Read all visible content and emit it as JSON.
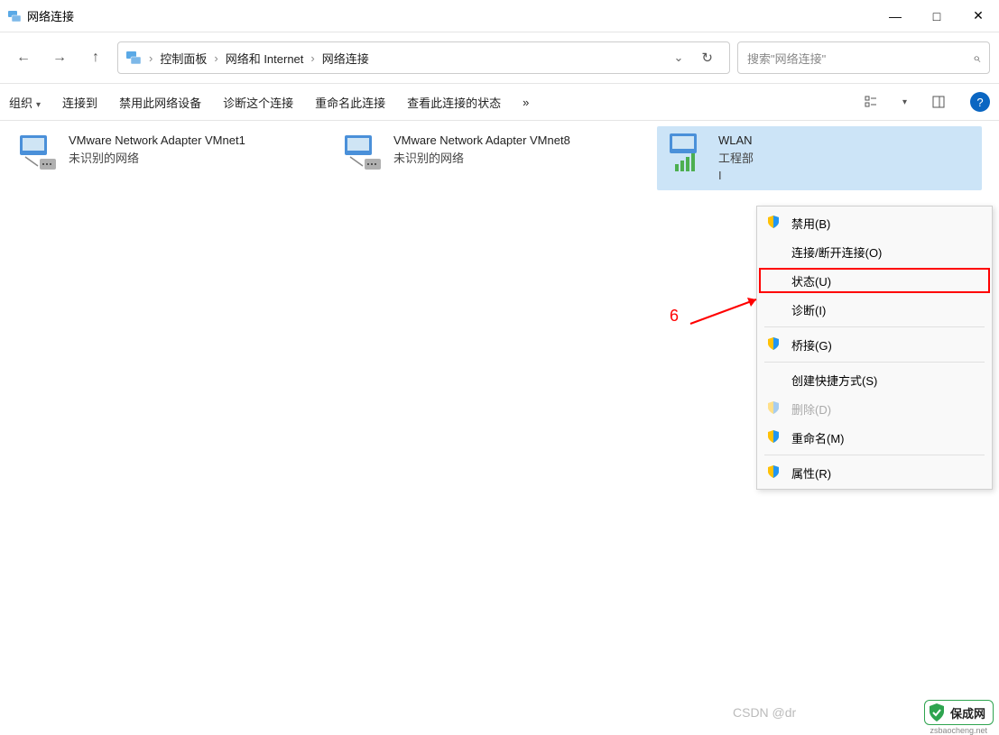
{
  "window": {
    "title": "网络连接",
    "minimize": "—",
    "maximize": "□",
    "close": "✕"
  },
  "breadcrumb": {
    "seg1": "控制面板",
    "seg2": "网络和 Internet",
    "seg3": "网络连接"
  },
  "search": {
    "placeholder": "搜索\"网络连接\""
  },
  "toolbar": {
    "organize": "组织",
    "connect": "连接到",
    "disable": "禁用此网络设备",
    "diagnose": "诊断这个连接",
    "rename": "重命名此连接",
    "viewstatus": "查看此连接的状态",
    "more": "»"
  },
  "adapters": [
    {
      "name": "VMware Network Adapter VMnet1",
      "status": "未识别的网络"
    },
    {
      "name": "VMware Network Adapter VMnet8",
      "status": "未识别的网络"
    },
    {
      "name": "WLAN",
      "sub": "工程部",
      "status": "I"
    }
  ],
  "context_menu": {
    "items": [
      {
        "label": "禁用(B)",
        "shield": true
      },
      {
        "label": "连接/断开连接(O)"
      },
      {
        "label": "状态(U)",
        "highlight": true
      },
      {
        "label": "诊断(I)"
      }
    ],
    "items2": [
      {
        "label": "桥接(G)",
        "shield": true
      }
    ],
    "items3": [
      {
        "label": "创建快捷方式(S)"
      },
      {
        "label": "删除(D)",
        "shield": true,
        "disabled": true
      },
      {
        "label": "重命名(M)",
        "shield": true
      }
    ],
    "items4": [
      {
        "label": "属性(R)",
        "shield": true
      }
    ]
  },
  "annotation": {
    "number": "6"
  },
  "footer": {
    "csdn": "CSDN @dr",
    "wm_text": "保成网",
    "wm_sub": "zsbaocheng.net"
  }
}
